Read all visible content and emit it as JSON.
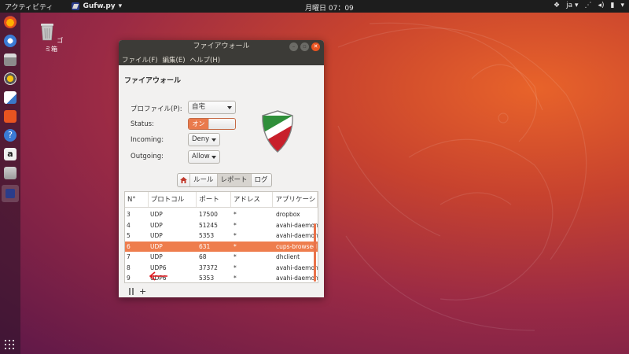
{
  "topbar": {
    "activities": "アクティビティ",
    "app_name": "Gufw.py",
    "clock": "月曜日 07：09",
    "lang": "ja"
  },
  "desktop": {
    "trash_label": "ゴミ箱"
  },
  "window": {
    "title": "ファイアウォール",
    "menu": [
      "ファイル(F)",
      "編集(E)",
      "ヘルプ(H)"
    ],
    "section_title": "ファイアウォール",
    "profile_label": "プロファイル(P):",
    "profile_value": "自宅",
    "status_label": "Status:",
    "status_value": "オン",
    "incoming_label": "Incoming:",
    "incoming_value": "Deny",
    "outgoing_label": "Outgoing:",
    "outgoing_value": "Allow",
    "tabs": [
      "ルール",
      "レポート",
      "ログ"
    ],
    "selected_tab": "レポート",
    "columns": [
      "N°",
      "プロトコル",
      "ポート",
      "アドレス",
      "アプリケーシ"
    ],
    "rows": [
      [
        "3",
        "UDP",
        "17500",
        "*",
        "dropbox"
      ],
      [
        "4",
        "UDP",
        "51245",
        "*",
        "avahi-daemon"
      ],
      [
        "5",
        "UDP",
        "5353",
        "*",
        "avahi-daemon"
      ],
      [
        "6",
        "UDP",
        "631",
        "*",
        "cups-browsed"
      ],
      [
        "7",
        "UDP",
        "68",
        "*",
        "dhclient"
      ],
      [
        "8",
        "UDP6",
        "37372",
        "*",
        "avahi-daemon"
      ],
      [
        "9",
        "UDP6",
        "5353",
        "*",
        "avahi-daemon"
      ]
    ],
    "selected_row": 3,
    "add_button": "+"
  },
  "colors": {
    "accent": "#e95420",
    "selection": "#ee7d4d",
    "titlebar": "#3c3b37",
    "window_bg": "#f2f1f0"
  }
}
